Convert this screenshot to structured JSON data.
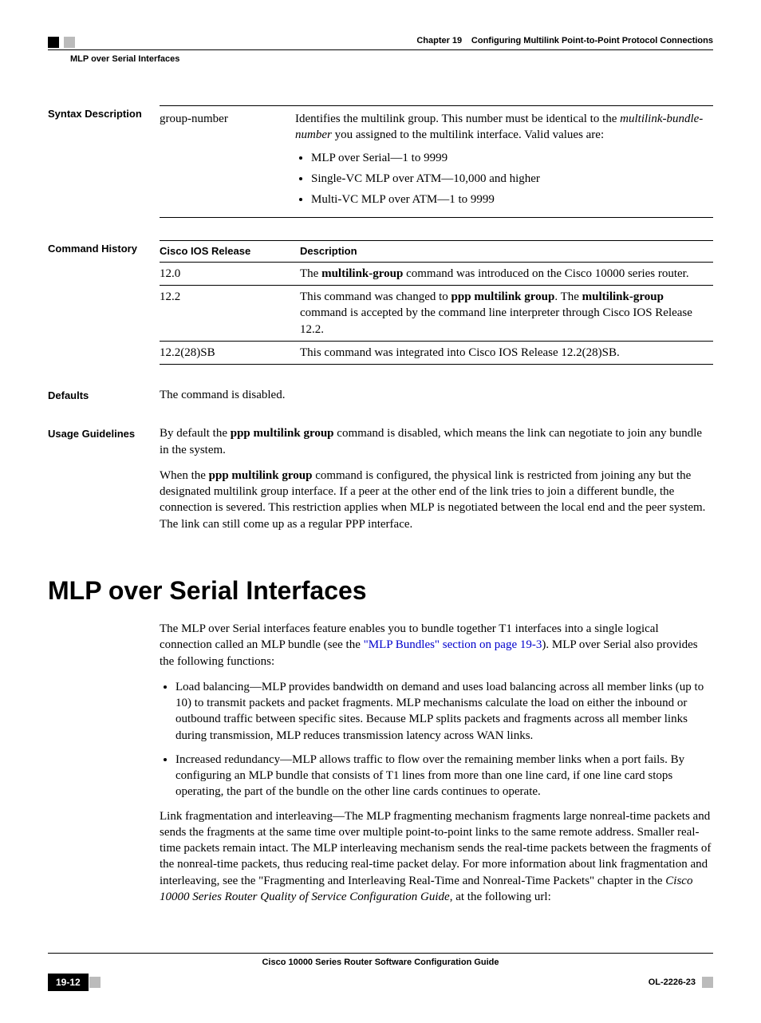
{
  "header": {
    "chapter_label": "Chapter 19",
    "chapter_title": "Configuring Multilink Point-to-Point Protocol Connections",
    "breadcrumb": "MLP over Serial Interfaces"
  },
  "syntax": {
    "label": "Syntax Description",
    "param": "group-number",
    "desc_pre": "Identifies the multilink group. This number must be identical to the ",
    "desc_em": "multilink-bundle-number",
    "desc_post": " you assigned to the multilink interface. Valid values are:",
    "bullets": [
      "MLP over Serial—1 to 9999",
      "Single-VC MLP over ATM—10,000 and higher",
      "Multi-VC MLP over ATM—1 to 9999"
    ]
  },
  "history": {
    "label": "Command History",
    "col1": "Cisco IOS Release",
    "col2": "Description",
    "rows": [
      {
        "release": "12.0",
        "pre": "The ",
        "b1": "multilink-group",
        "post": " command was introduced on the Cisco 10000 series router."
      },
      {
        "release": "12.2",
        "pre": "This command was changed to ",
        "b1": "ppp multilink group",
        "mid": ". The ",
        "b2": "multilink-group",
        "post": " command is accepted by the command line interpreter through Cisco IOS Release 12.2."
      },
      {
        "release": "12.2(28)SB",
        "pre": "This command was integrated into Cisco IOS Release 12.2(28)SB.",
        "b1": "",
        "mid": "",
        "b2": "",
        "post": ""
      }
    ]
  },
  "defaults": {
    "label": "Defaults",
    "text": "The command is disabled."
  },
  "usage": {
    "label": "Usage Guidelines",
    "p1_pre": "By default the ",
    "p1_b": "ppp multilink group",
    "p1_post": " command is disabled, which means the link can negotiate to join any bundle in the system.",
    "p2_pre": "When the ",
    "p2_b": "ppp multilink group",
    "p2_post": " command is configured, the physical link is restricted from joining any but the designated multilink group interface. If a peer at the other end of the link tries to join a different bundle, the connection is severed. This restriction applies when MLP is negotiated between the local end and the peer system. The link can still come up as a regular PPP interface."
  },
  "main_heading": "MLP over Serial Interfaces",
  "body": {
    "intro_pre": "The MLP over Serial interfaces feature enables you to bundle together T1 interfaces into a single logical connection called an MLP bundle (see the ",
    "intro_link": "\"MLP Bundles\" section on page 19-3",
    "intro_post": "). MLP over Serial also provides the following functions:",
    "bullets": [
      "Load balancing—MLP provides bandwidth on demand and uses load balancing across all member links (up to 10) to transmit packets and packet fragments. MLP mechanisms calculate the load on either the inbound or outbound traffic between specific sites. Because MLP splits packets and fragments across all member links during transmission, MLP reduces transmission latency across WAN links.",
      "Increased redundancy—MLP allows traffic to flow over the remaining member links when a port fails. By configuring an MLP bundle that consists of T1 lines from more than one line card, if one line card stops operating, the part of the bundle on the other line cards continues to operate."
    ],
    "frag_pre": "Link fragmentation and interleaving—The MLP fragmenting mechanism fragments large nonreal-time packets and sends the fragments at the same time over multiple point-to-point links to the same remote address. Smaller real-time packets remain intact. The MLP interleaving mechanism sends the real-time packets between the fragments of the nonreal-time packets, thus reducing real-time packet delay. For more information about link fragmentation and interleaving, see the \"Fragmenting and Interleaving Real-Time and Nonreal-Time Packets\" chapter in the ",
    "frag_em": "Cisco 10000 Series Router Quality of Service Configuration Guide",
    "frag_post": ", at the following url:"
  },
  "footer": {
    "title": "Cisco 10000 Series Router Software Configuration Guide",
    "page": "19-12",
    "docnum": "OL-2226-23"
  }
}
